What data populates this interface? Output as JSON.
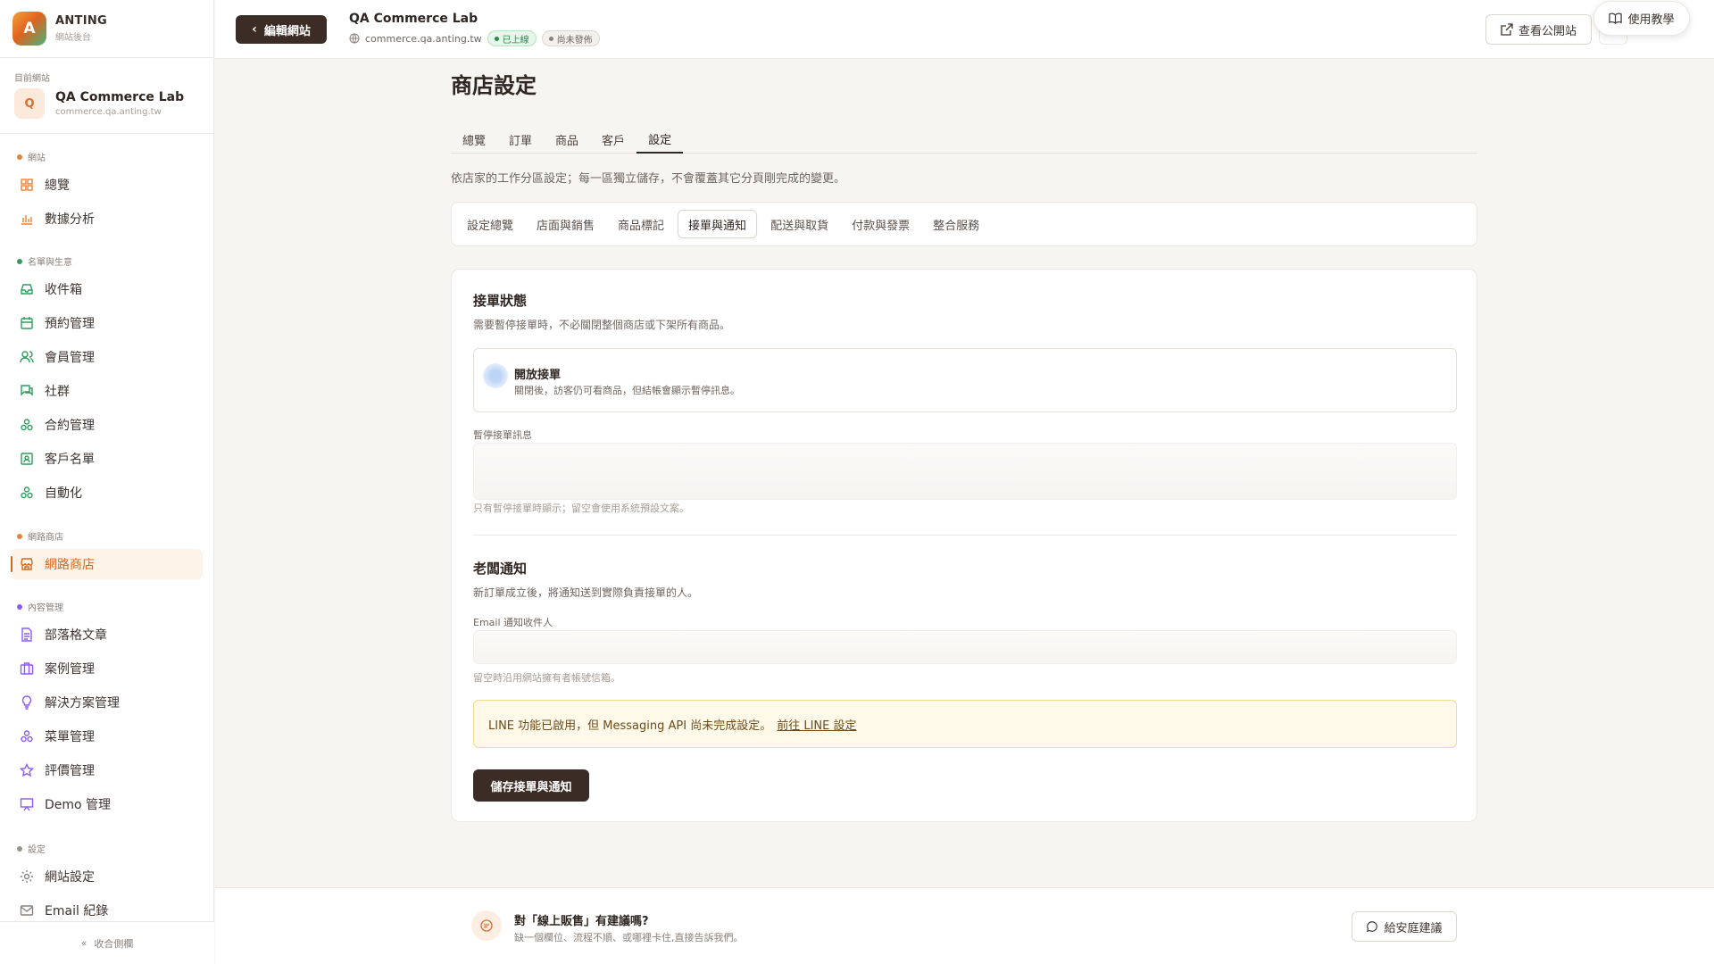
{
  "brand": {
    "name": "ANTING",
    "sub": "網站後台",
    "initial": "A"
  },
  "site": {
    "caption": "目前網站",
    "initial": "Q",
    "name": "QA Commerce Lab",
    "url": "commerce.qa.anting.tw"
  },
  "sidebar": {
    "sections": [
      {
        "label": "網站",
        "color": "#e8823a"
      },
      {
        "label": "名單與生意",
        "color": "#2f9e5c"
      },
      {
        "label": "網路商店",
        "color": "#e8823a"
      },
      {
        "label": "內容管理",
        "color": "#8b5cf6"
      },
      {
        "label": "設定",
        "color": "#9a928b"
      }
    ],
    "items": [
      {
        "label": "總覽",
        "icon": "grid-icon"
      },
      {
        "label": "數據分析",
        "icon": "bar-chart-icon"
      },
      {
        "label": "收件箱",
        "icon": "inbox-icon"
      },
      {
        "label": "預約管理",
        "icon": "calendar-icon"
      },
      {
        "label": "會員管理",
        "icon": "users-icon"
      },
      {
        "label": "社群",
        "icon": "chat-icon"
      },
      {
        "label": "合約管理",
        "icon": "cluster-icon"
      },
      {
        "label": "客戶名單",
        "icon": "contact-icon"
      },
      {
        "label": "自動化",
        "icon": "cluster-icon"
      },
      {
        "label": "網路商店",
        "icon": "store-icon",
        "active": true
      },
      {
        "label": "部落格文章",
        "icon": "document-icon"
      },
      {
        "label": "案例管理",
        "icon": "briefcase-icon"
      },
      {
        "label": "解決方案管理",
        "icon": "lightbulb-icon"
      },
      {
        "label": "菜單管理",
        "icon": "cluster-icon"
      },
      {
        "label": "評價管理",
        "icon": "star-icon"
      },
      {
        "label": "Demo 管理",
        "icon": "presentation-icon"
      },
      {
        "label": "網站設定",
        "icon": "gear-icon"
      },
      {
        "label": "Email 紀錄",
        "icon": "mail-icon"
      }
    ],
    "collapse_label": "收合側欄"
  },
  "topbar": {
    "back_label": "編輯網站",
    "site_name": "QA Commerce Lab",
    "site_url": "commerce.qa.anting.tw",
    "badge_live": "已上線",
    "badge_draft": "尚未發佈",
    "view_site": "查看公開站",
    "tutorial": "使用教學"
  },
  "page": {
    "title": "商店設定",
    "tabs": [
      "總覽",
      "訂單",
      "商品",
      "客戶",
      "設定"
    ],
    "active_tab": 4,
    "intro": "依店家的工作分區設定；每一區獨立儲存，不會覆蓋其它分頁剛完成的變更。",
    "subtabs": [
      "設定總覽",
      "店面與銷售",
      "商品標記",
      "接單與通知",
      "配送與取貨",
      "付款與發票",
      "整合服務"
    ],
    "active_subtab": 3
  },
  "order_section": {
    "title": "接單狀態",
    "desc": "需要暫停接單時，不必關閉整個商店或下架所有商品。",
    "toggle_title": "開放接單",
    "toggle_desc": "關閉後，訪客仍可看商品，但結帳會顯示暫停訊息。",
    "pause_label": "暫停接單訊息",
    "pause_value": "",
    "pause_hint": "只有暫停接單時顯示；留空會使用系統預設文案。"
  },
  "notify_section": {
    "title": "老闆通知",
    "desc": "新訂單成立後，將通知送到實際負責接單的人。",
    "email_label": "Email 通知收件人",
    "email_value": "",
    "email_hint": "留空時沿用網站擁有者帳號信箱。",
    "alert_text": "LINE 功能已啟用，但 Messaging API 尚未完成設定。",
    "alert_link": "前往 LINE 設定",
    "save_label": "儲存接單與通知"
  },
  "footer": {
    "title": "對「線上販售」有建議嗎?",
    "sub": "缺一個欄位、流程不順、或哪裡卡住,直接告訴我們。",
    "button": "給安庭建議"
  }
}
